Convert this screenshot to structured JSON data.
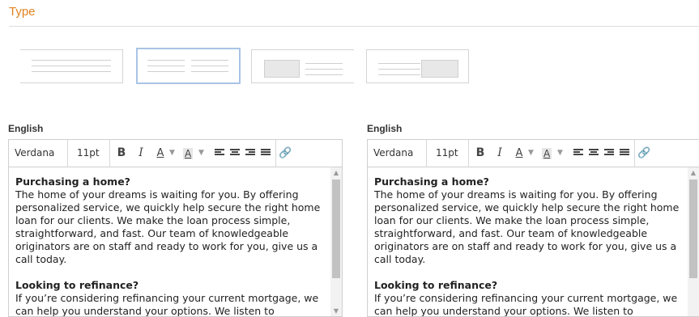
{
  "section": {
    "title": "Type"
  },
  "layout_options": [
    {
      "name": "full-width-text",
      "selected": false
    },
    {
      "name": "two-column-text",
      "selected": true
    },
    {
      "name": "image-left-text-right",
      "selected": false
    },
    {
      "name": "text-left-image-right",
      "selected": false
    }
  ],
  "editors": [
    {
      "language": "English",
      "toolbar": {
        "font": "Verdana",
        "size": "11pt",
        "bold": "B",
        "italic": "I",
        "text_color": "A",
        "highlight": "A"
      },
      "heading1": "Purchasing a home?",
      "body1": "The home of your dreams is waiting for you. By offering personalized service, we quickly help secure the right home loan for our clients. We make the loan process simple, straightforward, and fast. Our team of knowledgeable originators are on staff and ready to work for you, give us a call today.",
      "heading2": "Looking to refinance?",
      "body2": "If you’re considering refinancing your current mortgage, we can help you understand your options. We listen to"
    },
    {
      "language": "English",
      "toolbar": {
        "font": "Verdana",
        "size": "11pt",
        "bold": "B",
        "italic": "I",
        "text_color": "A",
        "highlight": "A"
      },
      "heading1": "Purchasing a home?",
      "body1": "The home of your dreams is waiting for you. By offering personalized service, we quickly help secure the right home loan for our clients. We make the loan process simple, straightforward, and fast. Our team of knowledgeable originators are on staff and ready to work for you, give us a call today.",
      "heading2": "Looking to refinance?",
      "body2": "If you’re considering refinancing your current mortgage, we can help you understand your options. We listen to"
    }
  ]
}
